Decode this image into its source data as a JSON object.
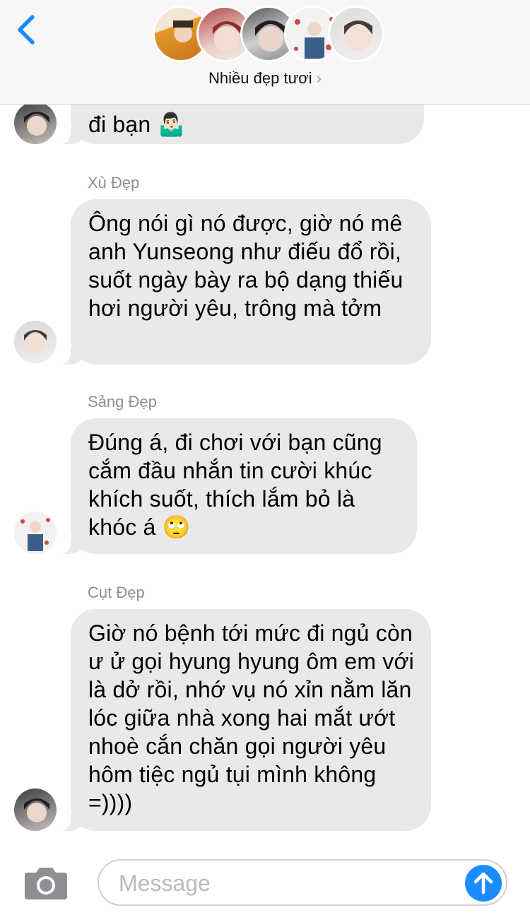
{
  "header": {
    "group_name": "Nhiều đẹp tươi",
    "chevron": "›",
    "back_icon": "chevron-left-icon",
    "accent_color": "#1a8cff"
  },
  "messages": [
    {
      "sender": "",
      "text": "đi bạn 🤷🏻‍♂️"
    },
    {
      "sender": "Xù Đẹp",
      "text": "Ông nói gì nó được, giờ nó mê anh Yunseong như điếu đổ rồi, suốt ngày bày ra bộ dạng thiếu hơi người yêu, trông mà tởm"
    },
    {
      "sender": "Sảng Đẹp",
      "text": "Đúng á, đi chơi với bạn cũng cắm đầu nhắn tin cười khúc khích suốt, thích lắm bỏ là khóc á 🙄"
    },
    {
      "sender": "Cụt Đẹp",
      "text": "Giờ nó bệnh tới mức đi ngủ còn ư ử gọi hyung hyung ôm em với là dở rồi, nhớ vụ nó xỉn nằm lăn lóc giữa nhà xong hai mắt ướt nhoè cắn chăn gọi người yêu hôm tiệc ngủ tụi mình không =))))"
    }
  ],
  "input": {
    "placeholder": "Message",
    "camera_icon": "camera-icon",
    "send_icon": "send-arrow-up-icon"
  }
}
